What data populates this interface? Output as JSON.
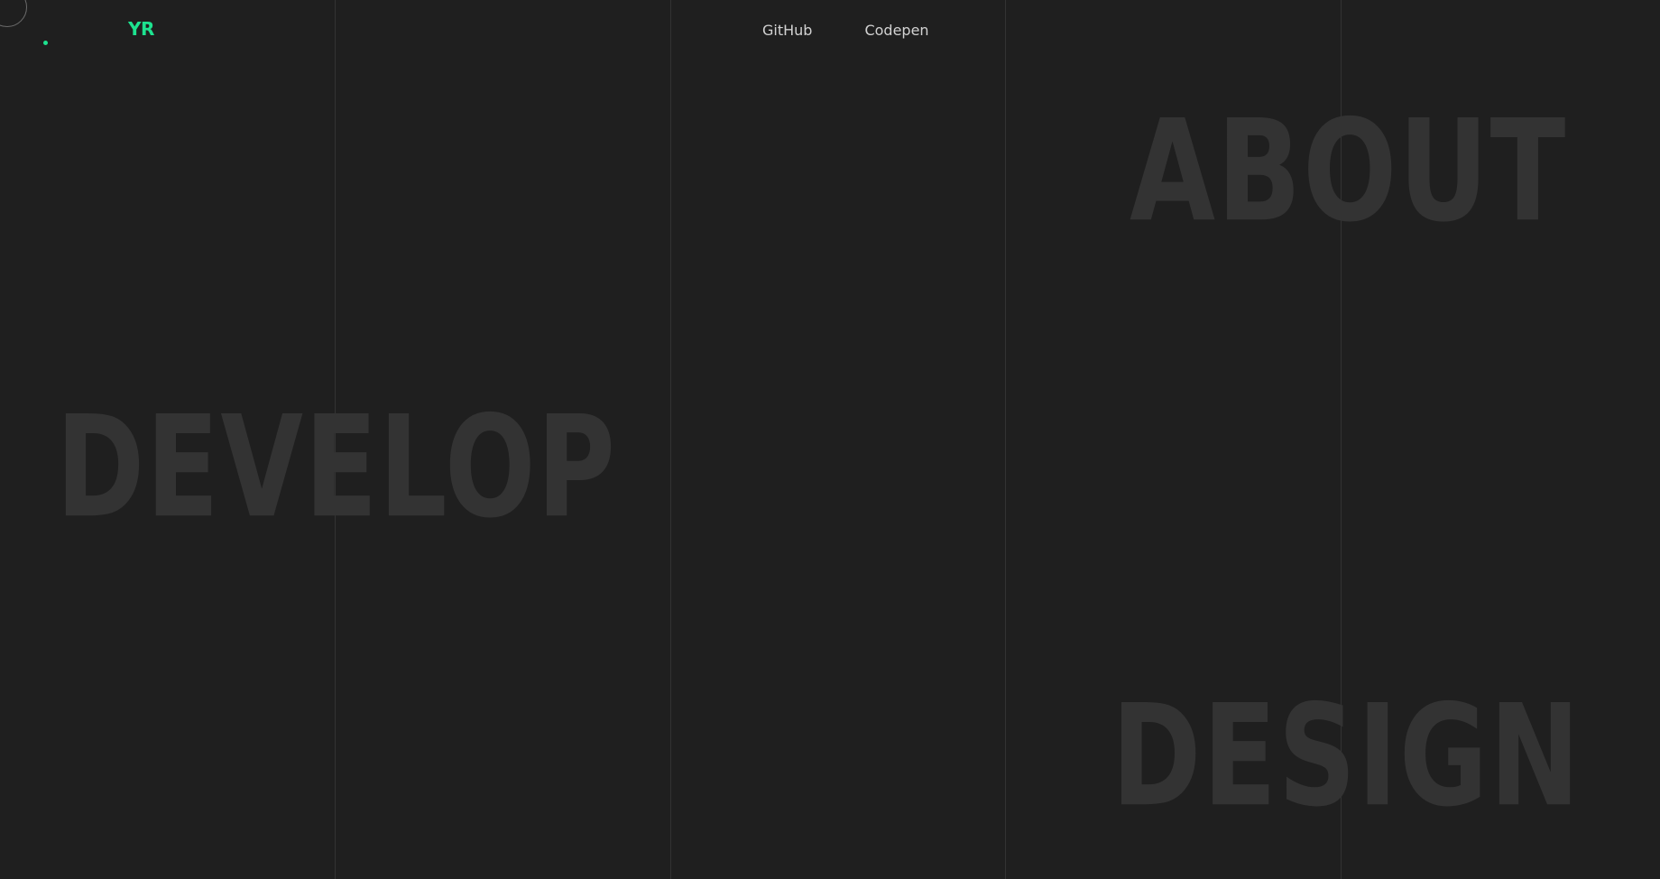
{
  "brand": {
    "logo_text": "YR",
    "accent_color": "#1de28f"
  },
  "nav": {
    "items": [
      {
        "label": "GitHub"
      },
      {
        "label": "Codepen"
      }
    ]
  },
  "sections": {
    "about": "ABOUT",
    "develop": "DEVELOP",
    "design": "DESIGN"
  },
  "colors": {
    "background": "#1f1f1f",
    "grid_line": "#333333",
    "big_text": "#333333",
    "nav_text": "#d2d2d2"
  }
}
